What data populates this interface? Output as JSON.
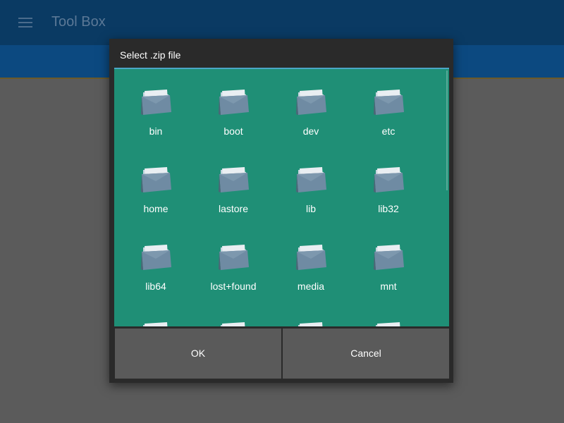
{
  "app": {
    "title": "Tool Box"
  },
  "dialog": {
    "title": "Select .zip file",
    "ok_label": "OK",
    "cancel_label": "Cancel"
  },
  "folders": [
    "bin",
    "boot",
    "dev",
    "etc",
    "home",
    "lastore",
    "lib",
    "lib32",
    "lib64",
    "lost+found",
    "media",
    "mnt"
  ],
  "icons": {
    "menu": "hamburger-menu-icon",
    "folder": "folder-icon"
  },
  "colors": {
    "app_bar": "#0a3a63",
    "dialog_bg": "#2a2a2a",
    "grid_bg": "#1f8f76",
    "button_bg": "#5a5a5a",
    "accent_line": "#4aa6c6"
  }
}
